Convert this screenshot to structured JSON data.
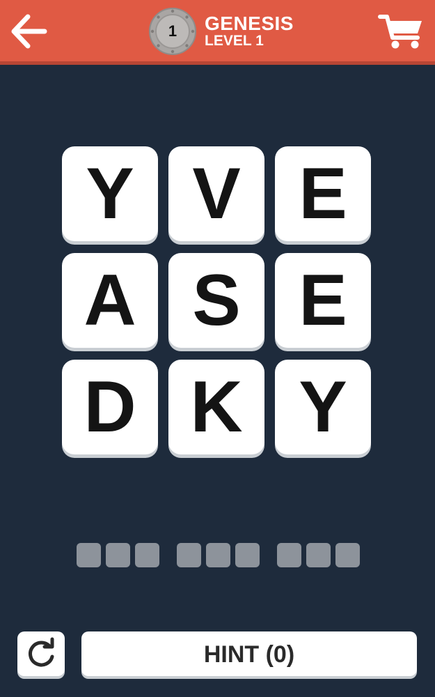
{
  "header": {
    "level_number": "1",
    "title": "GENESIS",
    "subtitle": "LEVEL 1",
    "back_icon": "arrow-left-icon",
    "cart_icon": "shopping-cart-icon",
    "badge_icon": "level-medal-icon"
  },
  "board": {
    "tiles": [
      "Y",
      "V",
      "E",
      "A",
      "S",
      "E",
      "D",
      "K",
      "Y"
    ]
  },
  "answer": {
    "word_lengths": [
      3,
      3,
      3
    ],
    "letters": [
      "",
      "",
      "",
      "",
      "",
      "",
      "",
      "",
      ""
    ]
  },
  "footer": {
    "reset_icon": "refresh-icon",
    "hint_label": "HINT (0)"
  },
  "colors": {
    "header_bg": "#e05a44",
    "background": "#1e2b3c",
    "tile_bg": "#ffffff",
    "slot": "#8d939b"
  }
}
